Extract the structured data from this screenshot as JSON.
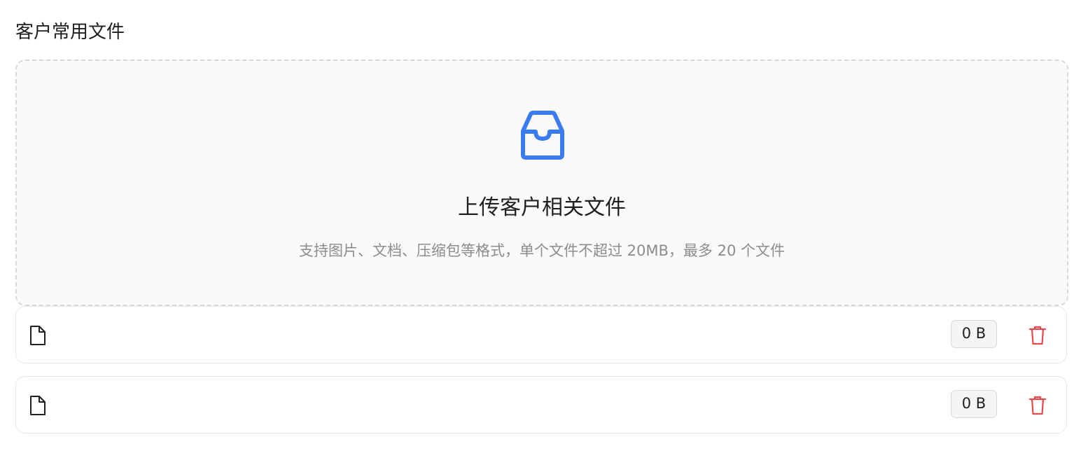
{
  "section": {
    "title": "客户常用文件"
  },
  "upload": {
    "icon": "inbox-icon",
    "title": "上传客户相关文件",
    "hint": "支持图片、文档、压缩包等格式，单个文件不超过 20MB，最多 20 个文件"
  },
  "files": [
    {
      "name": "",
      "size": "0 B",
      "icon": "file-icon",
      "action_icon": "trash-icon"
    },
    {
      "name": "",
      "size": "0 B",
      "icon": "file-icon",
      "action_icon": "trash-icon"
    }
  ],
  "colors": {
    "accent": "#3b7bf0",
    "danger": "#e5484d",
    "dropzone_bg": "#fafafa",
    "border": "#d9d9d9",
    "muted_text": "#8c8c8c"
  }
}
